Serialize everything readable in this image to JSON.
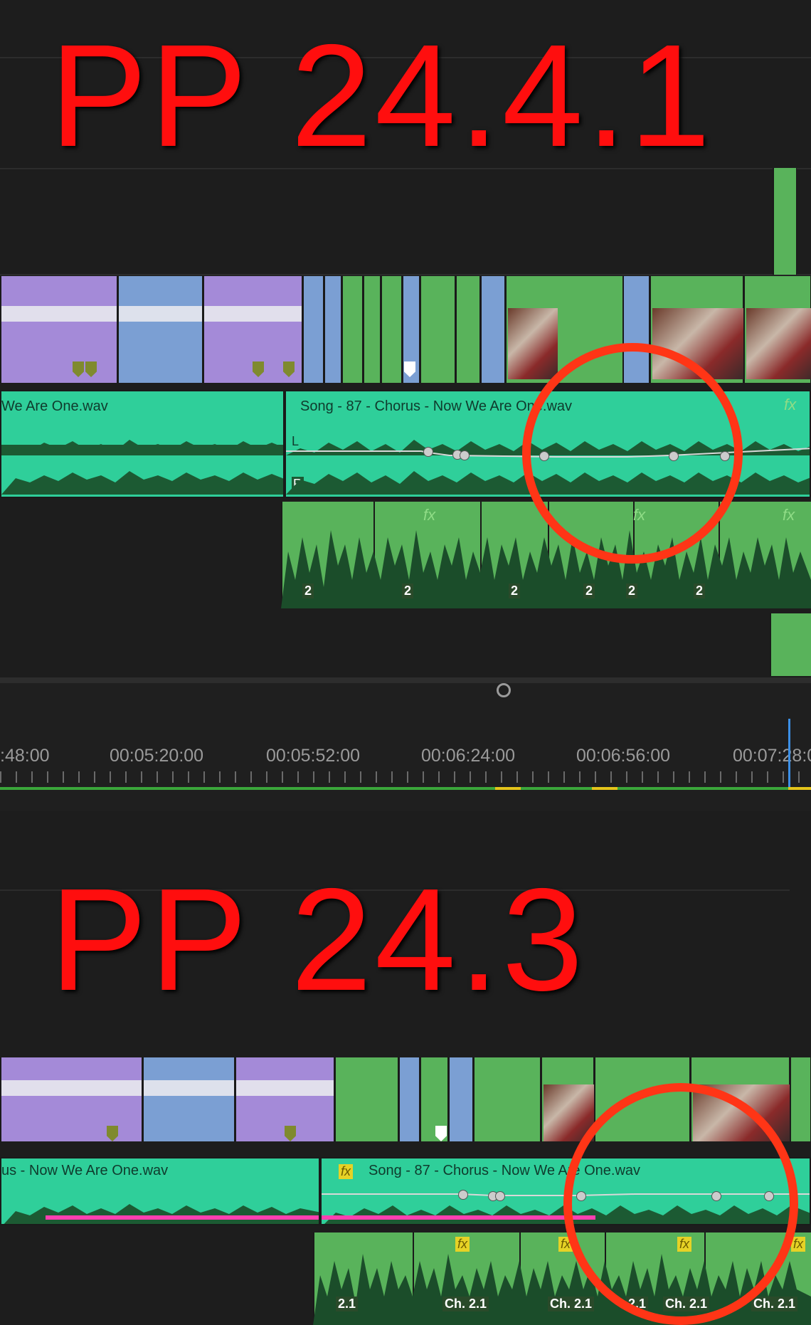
{
  "top": {
    "label": "PP 24.4.1",
    "audio_clip_1_name": "We Are One.wav",
    "audio_clip_2_name": "Song - 87 - Chorus - Now We Are One.wav",
    "channel_left": "L",
    "channel_right": "R",
    "clip_channel_badges": [
      "2",
      "2",
      "2",
      "2",
      "2",
      "2"
    ],
    "fx_badge": "fx"
  },
  "ruler": {
    "timecodes": [
      ":48:00",
      "00:05:20:00",
      "00:05:52:00",
      "00:06:24:00",
      "00:06:56:00",
      "00:07:28:00"
    ]
  },
  "bottom": {
    "label": "PP 24.3",
    "audio_clip_1_name": "us - Now We Are One.wav",
    "audio_clip_2_name": "Song - 87 - Chorus - Now We Are One.wav",
    "clip_channel_badges": [
      "2.1",
      "Ch. 2.1",
      "Ch. 2.1",
      "2.1",
      "Ch. 2.1",
      "Ch. 2.1"
    ],
    "fx_badge": "fx"
  },
  "colors": {
    "highlight_ring": "#ff3516",
    "label_red": "#ff0e0e",
    "audio_teal": "#2fcf9a",
    "clip_green": "#59b35b",
    "clip_purple": "#a48ad8",
    "clip_blue": "#7b9fd3"
  }
}
